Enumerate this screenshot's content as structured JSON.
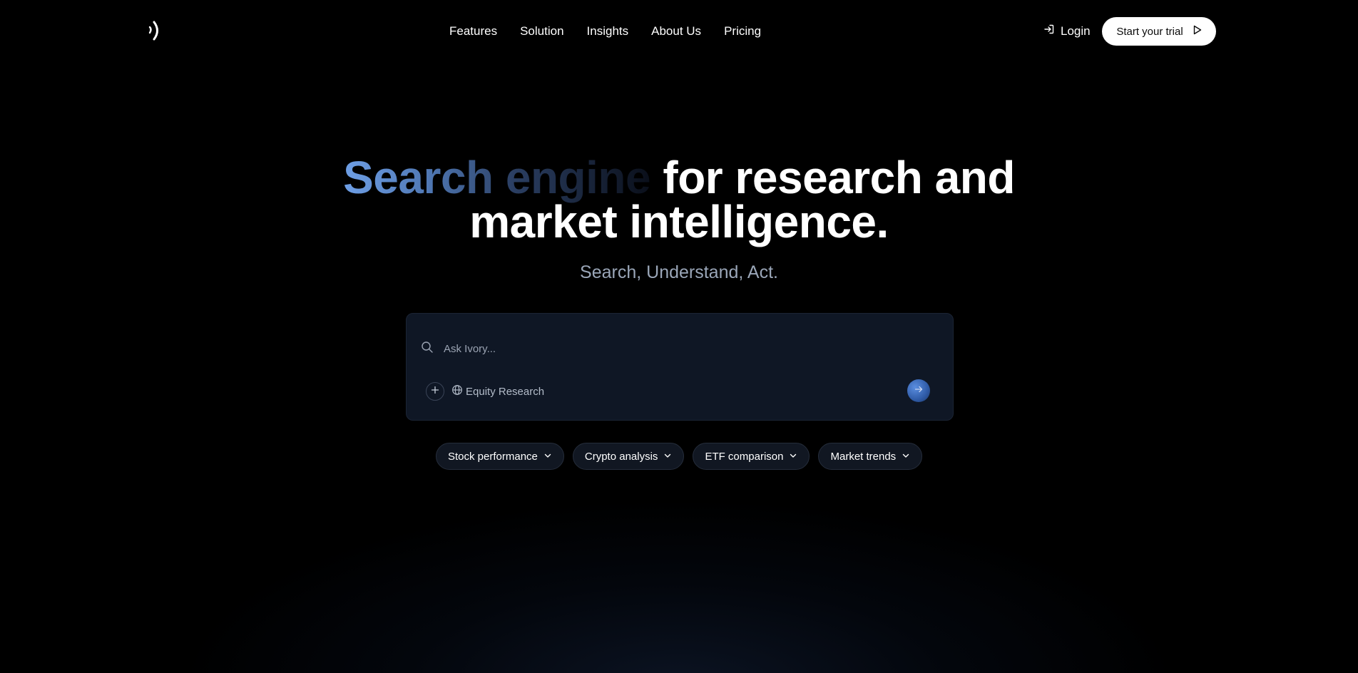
{
  "header": {
    "nav": [
      {
        "label": "Features"
      },
      {
        "label": "Solution"
      },
      {
        "label": "Insights"
      },
      {
        "label": "About Us"
      },
      {
        "label": "Pricing"
      }
    ],
    "login_label": "Login",
    "trial_label": "Start your trial"
  },
  "hero": {
    "title_highlight": "Search engine",
    "title_line1_rest": " for research and",
    "title_line2": "market intelligence.",
    "subtitle": "Search, Understand, Act."
  },
  "search": {
    "placeholder": "Ask Ivory...",
    "value": "",
    "mode_label": "Equity Research"
  },
  "chips": [
    {
      "label": "Stock performance"
    },
    {
      "label": "Crypto analysis"
    },
    {
      "label": "ETF comparison"
    },
    {
      "label": "Market trends"
    }
  ],
  "colors": {
    "background": "#000000",
    "card": "#0f1725",
    "accent": "#6e9fe6",
    "subtitle": "#9aa6b8"
  },
  "icons": {
    "logo": "brand-logo-icon",
    "login": "login-icon",
    "trial": "play-icon",
    "search": "search-icon",
    "plus": "plus-icon",
    "mode": "globe-icon",
    "send": "arrow-right-icon",
    "chip": "chevron-down-icon"
  }
}
